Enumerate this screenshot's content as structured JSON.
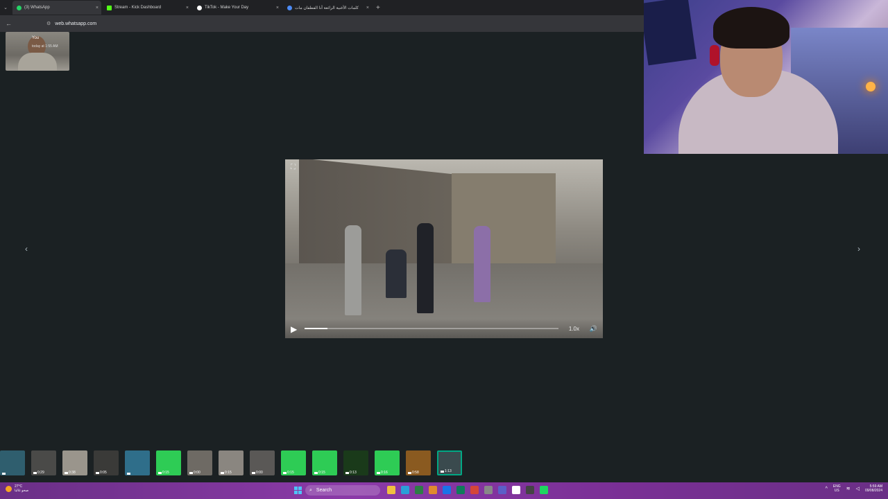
{
  "browser": {
    "tabs": [
      {
        "title": "(3) WhatsApp",
        "favicon_color": "#25d366",
        "active": true
      },
      {
        "title": "Stream - Kick Dashboard",
        "favicon_color": "#53fc18",
        "active": false
      },
      {
        "title": "TikTok - Make Your Day",
        "favicon_color": "#ffffff",
        "active": false
      },
      {
        "title": "كلمات الأغنية الرائعة أنا الفطفان مات",
        "favicon_color": "#4c8bf5",
        "active": false
      }
    ],
    "close_glyph": "×",
    "new_tab_glyph": "+",
    "url": "web.whatsapp.com"
  },
  "overlay": {
    "you_label": "You",
    "time_label": "today at 1:55 AM"
  },
  "viewer": {
    "playback_speed": "1.0x",
    "progress": 0.09,
    "play_icon": "play-icon",
    "volume_icon": "volume-icon",
    "fullscreen_icon": "fullscreen-icon"
  },
  "thumbnails": [
    {
      "duration": "",
      "color": "#2f5e6e"
    },
    {
      "duration": "0:29",
      "color": "#4a4a48"
    },
    {
      "duration": "0:38",
      "color": "#9a958c"
    },
    {
      "duration": "0:05",
      "color": "#3a3a38"
    },
    {
      "duration": "",
      "color": "#2f6e8a"
    },
    {
      "duration": "0:15",
      "color": "#2ecc55"
    },
    {
      "duration": "0:00",
      "color": "#6e6a64"
    },
    {
      "duration": "0:15",
      "color": "#8a8680"
    },
    {
      "duration": "0:00",
      "color": "#5a5856"
    },
    {
      "duration": "0:15",
      "color": "#2ecc55"
    },
    {
      "duration": "0:15",
      "color": "#2ecc55"
    },
    {
      "duration": "0:13",
      "color": "#1a3a1a"
    },
    {
      "duration": "0:16",
      "color": "#2ecc55"
    },
    {
      "duration": "0:58",
      "color": "#8a5a20"
    },
    {
      "duration": "1:13",
      "color": "#3a4a4e"
    }
  ],
  "taskbar": {
    "weather_temp": "27°C",
    "weather_desc": "صحو غالبا",
    "search_label": "Search",
    "lang_top": "ENG",
    "lang_bottom": "US",
    "time": "5:59 AM",
    "date": "09/08/2024",
    "apps": [
      "#f0c040",
      "#2b9fd8",
      "#2d7d46",
      "#e08a2e",
      "#1a73e8",
      "#0f7b5a",
      "#d44638",
      "#888888",
      "#5b5fc7",
      "#ffffff",
      "#444444",
      "#1ed760"
    ]
  },
  "colors": {
    "background": "#1b2123",
    "accent": "#00a884",
    "taskbar": "#7a2f95"
  }
}
